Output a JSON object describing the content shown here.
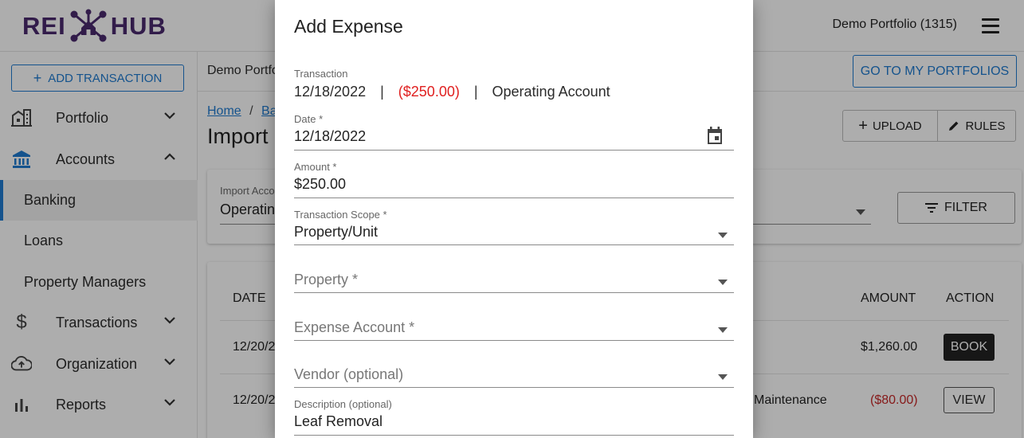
{
  "header": {
    "logo_left": "REI",
    "logo_right": "HUB",
    "portfolio_label": "Demo Portfolio (1315)"
  },
  "sidebar": {
    "add_transaction": "ADD TRANSACTION",
    "items": [
      {
        "label": "Portfolio",
        "icon": "building-icon"
      },
      {
        "label": "Accounts",
        "icon": "bank-icon"
      },
      {
        "label": "Transactions",
        "icon": "dollar-icon"
      },
      {
        "label": "Organization",
        "icon": "cloud-upload-icon"
      },
      {
        "label": "Reports",
        "icon": "bar-chart-icon"
      }
    ],
    "sub_items": [
      {
        "label": "Banking"
      },
      {
        "label": "Loans"
      },
      {
        "label": "Property Managers"
      }
    ]
  },
  "main": {
    "portfolio_title": "Demo Portfo",
    "go_to_portfolios": "GO TO MY PORTFOLIOS",
    "breadcrumb_home": "Home",
    "breadcrumb_sep": "/",
    "breadcrumb_next": "Ba",
    "page_title": "Import",
    "upload": "UPLOAD",
    "rules": "RULES",
    "import_label": "Import Acco",
    "import_value": "Operatin",
    "filter": "FILTER",
    "table": {
      "headers": {
        "date": "DATE",
        "amount": "AMOUNT",
        "action": "ACTION"
      },
      "rows": [
        {
          "date": "12/20/2",
          "amount": "$1,260.00",
          "action": "BOOK",
          "description": ""
        },
        {
          "date": "12/20/2",
          "amount": "($80.00)",
          "action": "VIEW",
          "description": "Maintenance"
        }
      ]
    }
  },
  "modal": {
    "title": "Add Expense",
    "transaction": {
      "label": "Transaction",
      "date": "12/18/2022",
      "sep": "|",
      "amount": "($250.00)",
      "account": "Operating Account"
    },
    "date": {
      "label": "Date *",
      "value": "12/18/2022"
    },
    "amount": {
      "label": "Amount *",
      "value": "$250.00"
    },
    "scope": {
      "label": "Transaction Scope *",
      "value": "Property/Unit"
    },
    "property": {
      "placeholder": "Property *"
    },
    "expense_account": {
      "placeholder": "Expense Account *"
    },
    "vendor": {
      "placeholder": "Vendor (optional)"
    },
    "description": {
      "label": "Description (optional)",
      "value": "Leaf Removal"
    }
  },
  "colors": {
    "brand_purple": "#4b2a6e",
    "accent_blue": "#1f7bd0",
    "negative_red": "#e02020"
  }
}
